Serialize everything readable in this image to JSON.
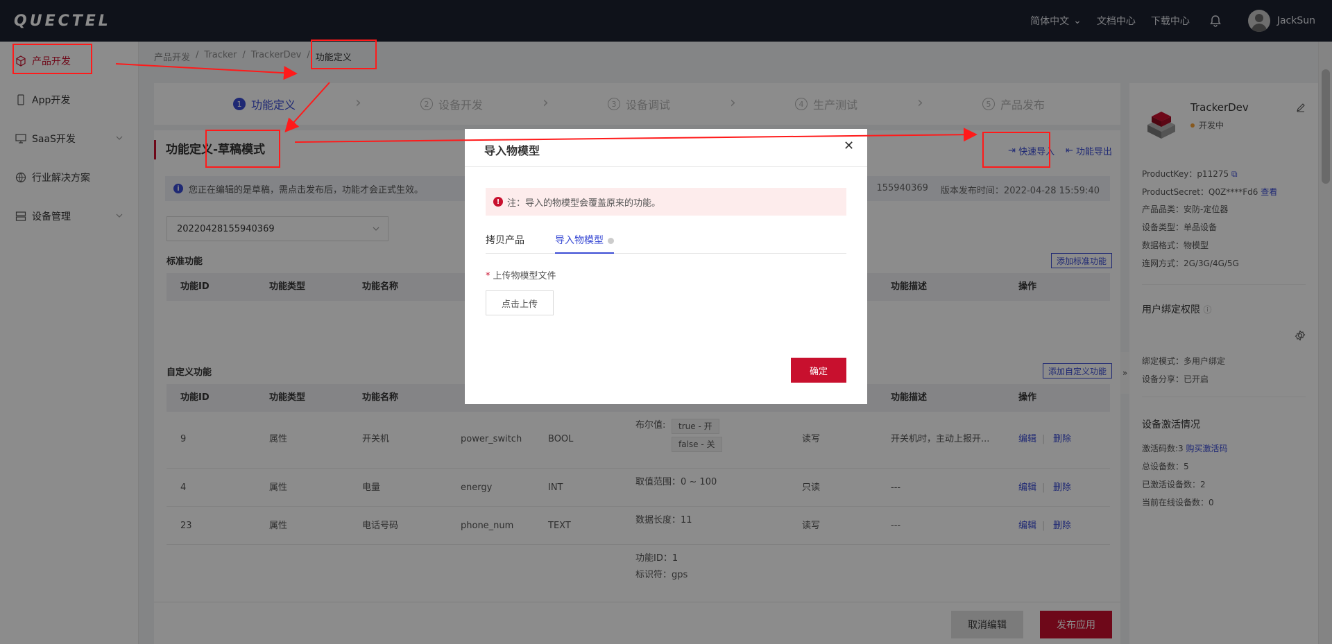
{
  "header": {
    "logo_text": "QUECTEL",
    "language": "简体中文",
    "docs": "文档中心",
    "downloads": "下载中心",
    "username": "JackSun"
  },
  "sidebar": {
    "items": [
      {
        "label": "产品开发",
        "icon": "cube-icon"
      },
      {
        "label": "App开发",
        "icon": "phone-icon"
      },
      {
        "label": "SaaS开发",
        "icon": "monitor-icon"
      },
      {
        "label": "行业解决方案",
        "icon": "globe-icon"
      },
      {
        "label": "设备管理",
        "icon": "server-icon"
      }
    ]
  },
  "breadcrumb": [
    "产品开发",
    "Tracker",
    "TrackerDev",
    "功能定义"
  ],
  "steps": [
    {
      "num": "1",
      "label": "功能定义"
    },
    {
      "num": "2",
      "label": "设备开发"
    },
    {
      "num": "3",
      "label": "设备调试"
    },
    {
      "num": "4",
      "label": "生产测试"
    },
    {
      "num": "5",
      "label": "产品发布"
    }
  ],
  "panel": {
    "title": "功能定义-草稿模式",
    "quick_import": "快速导入",
    "export": "功能导出",
    "notice": "您正在编辑的是草稿，需点击发布后，功能才会正式生效。",
    "version_partial": "155940369",
    "publish_time_label": "版本发布时间：",
    "publish_time": "2022-04-28 15:59:40",
    "version_select": "20220428155940369",
    "standard_title": "标准功能",
    "add_standard": "添加标准功能",
    "custom_title": "自定义功能",
    "add_custom": "添加自定义功能",
    "std_columns": [
      "功能ID",
      "功能类型",
      "功能名称",
      "功能描述",
      "操作"
    ],
    "custom_columns": [
      "功能ID",
      "功能类型",
      "功能名称",
      "功能描述",
      "操作"
    ],
    "rows": [
      {
        "id": "9",
        "type": "属性",
        "name": "开关机",
        "identifier": "power_switch",
        "dtype": "BOOL",
        "def_label": "布尔值:",
        "def_tag1": "true - 开",
        "def_tag2": "false - 关",
        "rw": "读写",
        "desc": "开关机时，主动上报开...",
        "edit": "编辑",
        "del": "删除"
      },
      {
        "id": "4",
        "type": "属性",
        "name": "电量",
        "identifier": "energy",
        "dtype": "INT",
        "def": "取值范围：0 ~ 100",
        "rw": "只读",
        "desc": "---",
        "edit": "编辑",
        "del": "删除"
      },
      {
        "id": "23",
        "type": "属性",
        "name": "电话号码",
        "identifier": "phone_num",
        "dtype": "TEXT",
        "def": "数据长度：11",
        "rw": "读写",
        "desc": "---",
        "edit": "编辑",
        "del": "删除"
      },
      {
        "def1": "功能ID：1",
        "def2": "标识符：gps"
      }
    ],
    "cancel": "取消编辑",
    "publish": "发布应用"
  },
  "info": {
    "product_name": "TrackerDev",
    "status": "开发中",
    "product_key": "ProductKey：p11275",
    "product_secret": "ProductSecret：Q0Z****Fd6",
    "view": "查看",
    "category": "产品品类：安防-定位器",
    "device_type": "设备类型：单品设备",
    "data_format": "数据格式：物模型",
    "network": "连网方式：2G/3G/4G/5G",
    "binding_title": "用户绑定权限",
    "binding_mode": "绑定模式：多用户绑定",
    "device_share": "设备分享：已开启",
    "activation_title": "设备激活情况",
    "activation_codes": "激活码数:3",
    "buy_codes": "购买激活码",
    "total_devices": "总设备数：5",
    "activated": "已激活设备数：2",
    "online": "当前在线设备数：0"
  },
  "modal": {
    "title": "导入物模型",
    "warning": "注：导入的物模型会覆盖原来的功能。",
    "tab_copy": "拷贝产品",
    "tab_import": "导入物模型",
    "upload_label": "上传物模型文件",
    "upload_button": "点击上传",
    "confirm": "确定"
  },
  "colors": {
    "brand_red": "#c8102e",
    "accent_blue": "#3a4bd4",
    "header_bg": "#1c2130",
    "annotation_red": "#ff1a1a"
  }
}
